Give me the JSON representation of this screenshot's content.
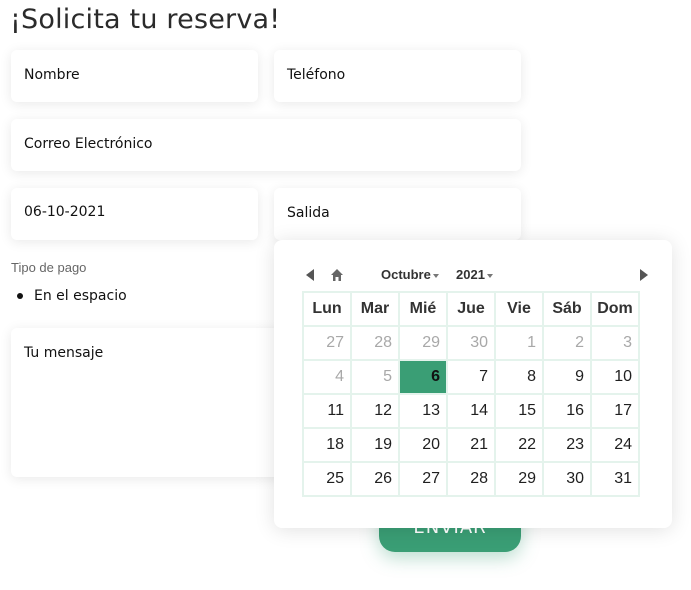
{
  "form": {
    "title": "¡Solicita tu reserva!",
    "name_placeholder": "Nombre",
    "phone_placeholder": "Teléfono",
    "email_placeholder": "Correo Electrónico",
    "checkin_value": "06-10-2021",
    "checkout_placeholder": "Salida",
    "payment_label": "Tipo de pago",
    "payment_option": "En el espacio",
    "message_placeholder": "Tu mensaje",
    "submit_label": "ENVIAR"
  },
  "calendar": {
    "month": "Octubre",
    "year": "2021",
    "weekdays": [
      "Lun",
      "Mar",
      "Mié",
      "Jue",
      "Vie",
      "Sáb",
      "Dom"
    ],
    "weeks": [
      [
        {
          "d": "27",
          "o": true
        },
        {
          "d": "28",
          "o": true
        },
        {
          "d": "29",
          "o": true
        },
        {
          "d": "30",
          "o": true
        },
        {
          "d": "1"
        },
        {
          "d": "2"
        },
        {
          "d": "3"
        }
      ],
      [
        {
          "d": "4"
        },
        {
          "d": "5"
        },
        {
          "d": "6",
          "sel": true
        },
        {
          "d": "7"
        },
        {
          "d": "8"
        },
        {
          "d": "9"
        },
        {
          "d": "10"
        }
      ],
      [
        {
          "d": "11"
        },
        {
          "d": "12"
        },
        {
          "d": "13"
        },
        {
          "d": "14"
        },
        {
          "d": "15"
        },
        {
          "d": "16"
        },
        {
          "d": "17"
        }
      ],
      [
        {
          "d": "18"
        },
        {
          "d": "19"
        },
        {
          "d": "20"
        },
        {
          "d": "21"
        },
        {
          "d": "22"
        },
        {
          "d": "23"
        },
        {
          "d": "24"
        }
      ],
      [
        {
          "d": "25"
        },
        {
          "d": "26"
        },
        {
          "d": "27"
        },
        {
          "d": "28"
        },
        {
          "d": "29"
        },
        {
          "d": "30"
        },
        {
          "d": "31"
        }
      ]
    ],
    "dim_current_month_days_before_today": true,
    "accent_color": "#3a9e75"
  }
}
